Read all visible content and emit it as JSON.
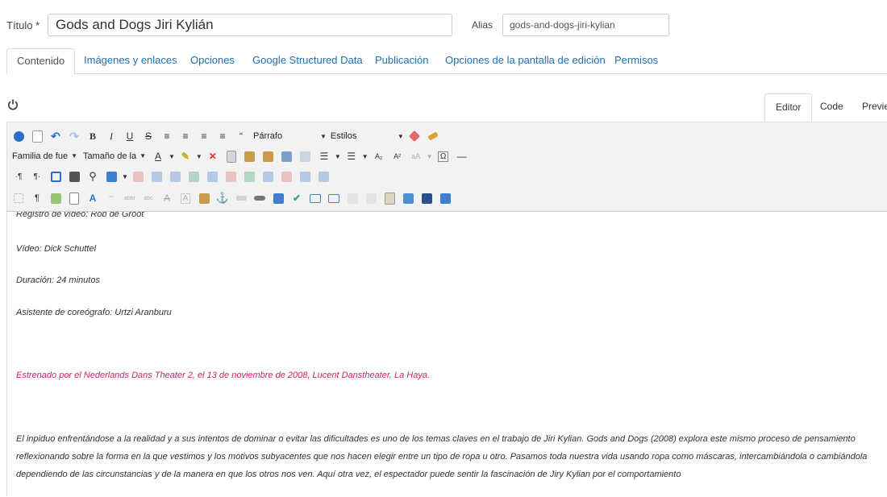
{
  "form": {
    "title_label": "Título *",
    "title_value": "Gods and Dogs Jiri Kylián",
    "alias_label": "Alias",
    "alias_value": "gods-and-dogs-jiri-kylian"
  },
  "tabs": [
    {
      "label": "Contenido",
      "active": true
    },
    {
      "label": "Imágenes y enlaces"
    },
    {
      "label": "Opciones"
    },
    {
      "label": "Google Structured Data"
    },
    {
      "label": "Publicación"
    },
    {
      "label": "Opciones de la pantalla de edición"
    },
    {
      "label": "Permisos"
    }
  ],
  "editor_tabs": [
    {
      "label": "Editor",
      "active": true
    },
    {
      "label": "Code"
    },
    {
      "label": "Previe"
    }
  ],
  "toolbar": {
    "format_select": "Párrafo",
    "styles_select": "Estilos",
    "font_family": "Familia de fue",
    "font_size": "Tamaño de la",
    "blockquote_glyph": "“",
    "subscript_glyph": "A₂",
    "superscript_glyph": "A²",
    "omega_glyph": "Ω"
  },
  "content": {
    "line1": "Registro de vídeo: Rob de Groot",
    "line2": "Vídeo: Dick Schuttel",
    "line3": "Duración: 24 minutos",
    "line4": "Asistente de coreógrafo: Urtzi Aranburu",
    "premiere": "Estrenado por el Nederlands Dans Theater 2, el 13 de noviembre de 2008, Lucent Danstheater, La Haya.",
    "paragraph": "El inpiduo enfrentándose a la realidad y a sus intentos de dominar o evitar las dificultades es uno de los temas claves en el trabajo de Jiri Kylian. Gods and Dogs (2008)  explora este mismo proceso de pensamiento reflexionando sobre la forma en la que vestimos y los motivos subyacentes que nos hacen elegir entre un tipo de ropa u otro. Pasamos toda nuestra vida usando ropa como máscaras, intercambiándola o cambiándola dependiendo de las circunstancias y de la manera en que los otros nos ven. Aquí otra vez, el espectador puede sentir la fascinación de Jiry Kylian por el comportamiento"
  },
  "colors": {
    "link": "#1f6fb2",
    "premiere_text": "#d0246b",
    "toolbar_bg": "#f2f2f2"
  }
}
